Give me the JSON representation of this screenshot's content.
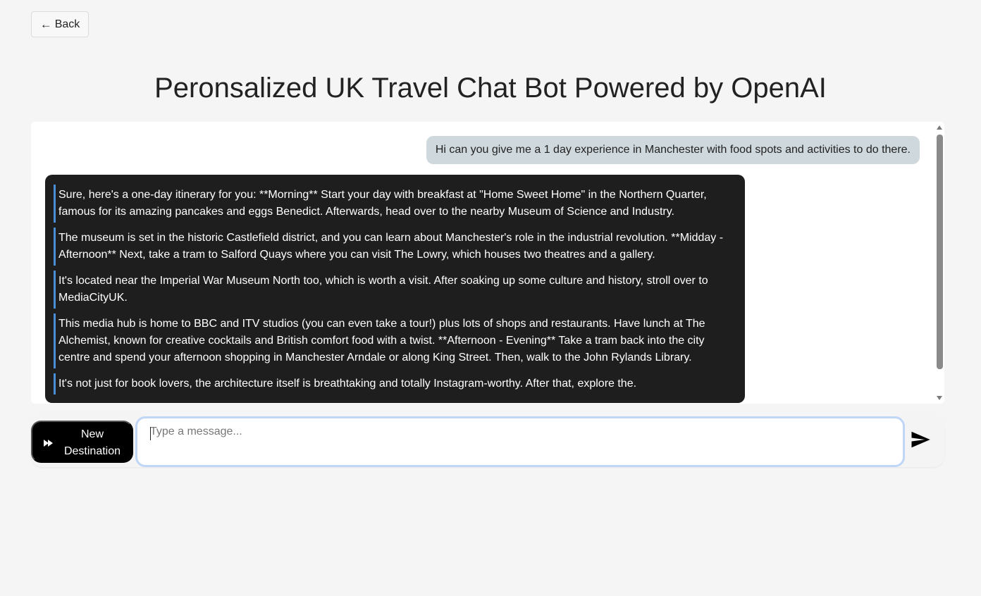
{
  "header": {
    "back_label": "Back",
    "back_icon": "left-arrow-icon",
    "title": "Peronsalized UK Travel Chat Bot Powered by OpenAI"
  },
  "chat": {
    "user_message": "Hi can you give me a 1 day experience in Manchester with food spots and activities to do there.",
    "bot_paragraphs": [
      "Sure, here's a one-day itinerary for you: **Morning** Start your day with breakfast at \"Home Sweet Home\" in the Northern Quarter, famous for its amazing pancakes and eggs Benedict. Afterwards, head over to the nearby Museum of Science and Industry.",
      "The museum is set in the historic Castlefield district, and you can learn about Manchester's role in the industrial revolution. **Midday - Afternoon** Next, take a tram to Salford Quays where you can visit The Lowry, which houses two theatres and a gallery.",
      "It's located near the Imperial War Museum North too, which is worth a visit. After soaking up some culture and history, stroll over to MediaCityUK.",
      "This media hub is home to BBC and ITV studios (you can even take a tour!) plus lots of shops and restaurants. Have lunch at The Alchemist, known for creative cocktails and British comfort food with a twist. **Afternoon - Evening** Take a tram back into the city centre and spend your afternoon shopping in Manchester Arndale or along King Street. Then, walk to the John Rylands Library.",
      "It's not just for book lovers, the architecture itself is breathtaking and totally Instagram-worthy. After that, explore the."
    ],
    "accent_color": "#4a90d9"
  },
  "composer": {
    "new_destination_label": "New\nDestination",
    "new_destination_icon": "fast-forward-icon",
    "input_placeholder": "Type a message...",
    "input_value": "",
    "send_icon": "send-icon"
  }
}
